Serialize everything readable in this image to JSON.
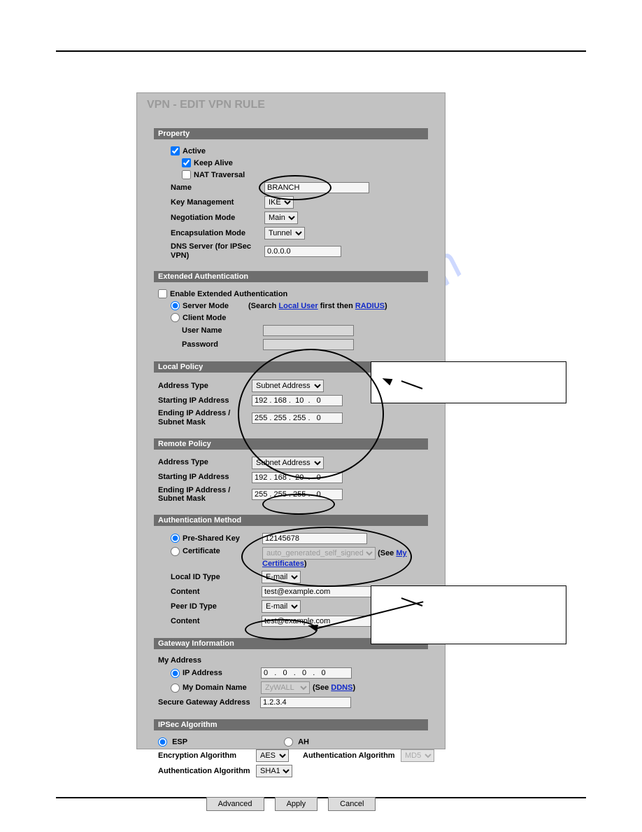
{
  "watermark": "manualshive.com",
  "title": "VPN - EDIT VPN RULE",
  "sections": {
    "property": {
      "head": "Property",
      "active_label": "Active",
      "active_checked": true,
      "keepalive_label": "Keep Alive",
      "keepalive_checked": true,
      "nat_label": "NAT Traversal",
      "nat_checked": false,
      "name_label": "Name",
      "name_value": "BRANCH",
      "keymgt_label": "Key Management",
      "keymgt_value": "IKE",
      "negmode_label": "Negotiation Mode",
      "negmode_value": "Main",
      "encap_label": "Encapsulation Mode",
      "encap_value": "Tunnel",
      "dns_label": "DNS Server (for IPSec VPN)",
      "dns_value": "0.0.0.0"
    },
    "extauth": {
      "head": "Extended Authentication",
      "enable_label": "Enable Extended Authentication",
      "enable_checked": false,
      "server_label": "Server Mode",
      "server_hint_pre": "(Search ",
      "server_link1": "Local User",
      "server_hint_mid": " first then ",
      "server_link2": "RADIUS",
      "server_hint_post": ")",
      "client_label": "Client Mode",
      "user_label": "User Name",
      "pass_label": "Password"
    },
    "local": {
      "head": "Local Policy",
      "addr_type_label": "Address Type",
      "addr_type_value": "Subnet Address",
      "start_label": "Starting IP Address",
      "start_value": "192 . 168 .  10  .   0",
      "end_label": "Ending IP Address / Subnet Mask",
      "end_value": "255 . 255 . 255 .   0"
    },
    "remote": {
      "head": "Remote Policy",
      "addr_type_label": "Address Type",
      "addr_type_value": "Subnet Address",
      "start_label": "Starting IP Address",
      "start_value": "192 . 168 .  20  .   0",
      "end_label": "Ending IP Address / Subnet Mask",
      "end_value": "255 . 255 . 255 .   0"
    },
    "auth": {
      "head": "Authentication Method",
      "psk_label": "Pre-Shared Key",
      "psk_value": "12145678",
      "cert_label": "Certificate",
      "cert_value": "auto_generated_self_signed_cert",
      "see_pre": "(See ",
      "cert_link": "My Certificates",
      "see_post": ")",
      "lid_label": "Local ID Type",
      "lid_value": "E-mail",
      "lcontent_label": "Content",
      "lcontent_value": "test@example.com",
      "pid_label": "Peer ID Type",
      "pid_value": "E-mail",
      "pcontent_label": "Content",
      "pcontent_value": "test@example.com"
    },
    "gw": {
      "head": "Gateway Information",
      "my_label": "My Address",
      "ip_label": "IP Address",
      "ip_value": "0   .   0   .   0   .   0",
      "dom_label": "My Domain Name",
      "dom_value": "ZyWALL",
      "dom_see_pre": "(See ",
      "dom_link": "DDNS",
      "dom_see_post": ")",
      "secgw_label": "Secure Gateway Address",
      "secgw_value": "1.2.3.4"
    },
    "ipsec": {
      "head": "IPSec Algorithm",
      "esp_label": "ESP",
      "ah_label": "AH",
      "enc_label": "Encryption Algorithm",
      "enc_value": "AES",
      "auth2_label": "Authentication Algorithm",
      "auth2_value": "MD5",
      "auth1_label": "Authentication Algorithm",
      "auth1_value": "SHA1"
    }
  },
  "buttons": {
    "advanced": "Advanced",
    "apply": "Apply",
    "cancel": "Cancel"
  }
}
